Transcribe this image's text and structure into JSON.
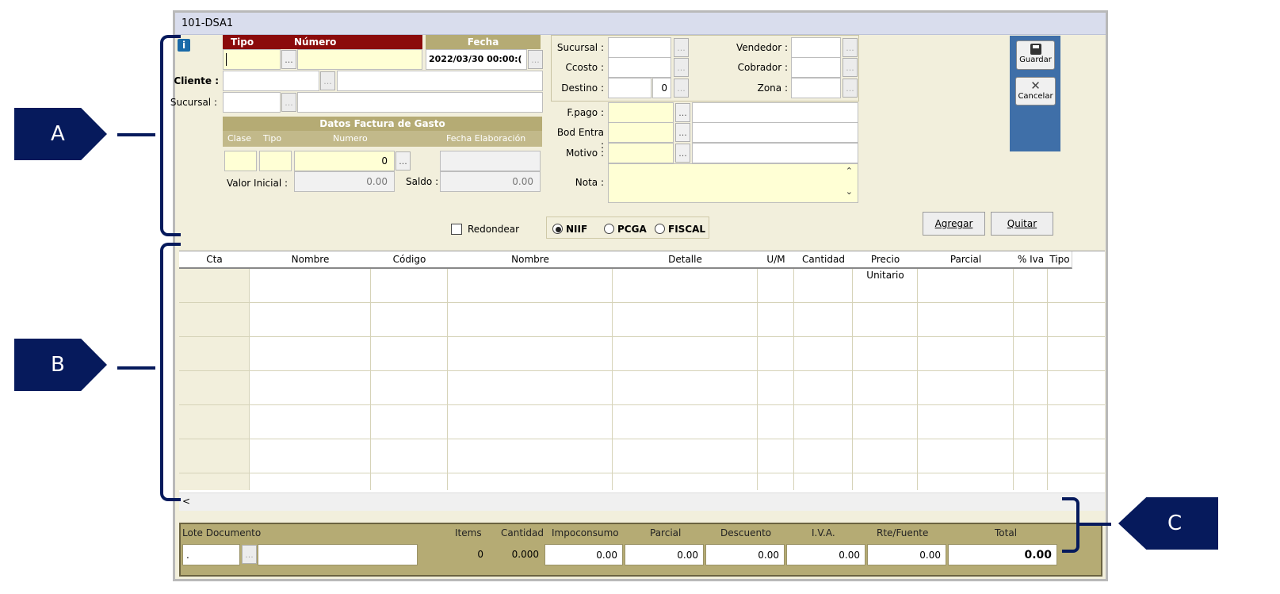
{
  "window": {
    "title": "101-DSA1"
  },
  "header": {
    "tipo_label": "Tipo",
    "numero_label": "Número",
    "fecha_label": "Fecha",
    "fecha_value": "2022/03/30 00:00:(",
    "cliente_label": "Cliente :",
    "sucursal_label": "Sucursal :"
  },
  "factura_gasto": {
    "title": "Datos Factura de Gasto",
    "col_clase": "Clase",
    "col_tipo": "Tipo",
    "col_numero": "Numero",
    "col_fecha": "Fecha Elaboración",
    "numero_value": "0",
    "valor_inicial_label": "Valor Inicial :",
    "valor_inicial_value": "0.00",
    "saldo_label": "Saldo :",
    "saldo_value": "0.00"
  },
  "right_fields": {
    "sucursal_label": "Sucursal :",
    "ccosto_label": "Ccosto :",
    "destino_label": "Destino :",
    "destino_value": "0",
    "vendedor_label": "Vendedor :",
    "cobrador_label": "Cobrador :",
    "zona_label": "Zona :",
    "fpago_label": "F.pago :",
    "bod_entra_label": "Bod Entra :",
    "motivo_label": "Motivo :",
    "nota_label": "Nota :"
  },
  "side_buttons": {
    "guardar": "Guardar",
    "cancelar": "Cancelar"
  },
  "actions": {
    "agregar": "Agregar",
    "quitar": "Quitar"
  },
  "options": {
    "redondear": "Redondear",
    "niif": "NIIF",
    "pcga": "PCGA",
    "fiscal": "FISCAL",
    "selected": "NIIF"
  },
  "grid": {
    "columns": [
      "Cta",
      "Nombre",
      "Código",
      "Nombre",
      "Detalle",
      "U/M",
      "Cantidad",
      "Precio Unitario",
      "Parcial",
      "% Iva",
      "Tipo"
    ],
    "scroll_left": "<"
  },
  "footer": {
    "lote_label": "Lote Documento",
    "lote_value": ".",
    "items_label": "Items",
    "items_value": "0",
    "cantidad_label": "Cantidad",
    "cantidad_value": "0.000",
    "impoconsumo_label": "Impoconsumo",
    "impoconsumo_value": "0.00",
    "parcial_label": "Parcial",
    "parcial_value": "0.00",
    "descuento_label": "Descuento",
    "descuento_value": "0.00",
    "iva_label": "I.V.A.",
    "iva_value": "0.00",
    "rtefuente_label": "Rte/Fuente",
    "rtefuente_value": "0.00",
    "total_label": "Total",
    "total_value": "0.00"
  },
  "callouts": {
    "a": "A",
    "b": "B",
    "c": "C"
  },
  "colors": {
    "navy": "#061a5c",
    "dark_red": "#8b0b0b",
    "olive": "#b5ab74",
    "blue_panel": "#3f6fa8",
    "field_yellow": "#ffffd5"
  }
}
